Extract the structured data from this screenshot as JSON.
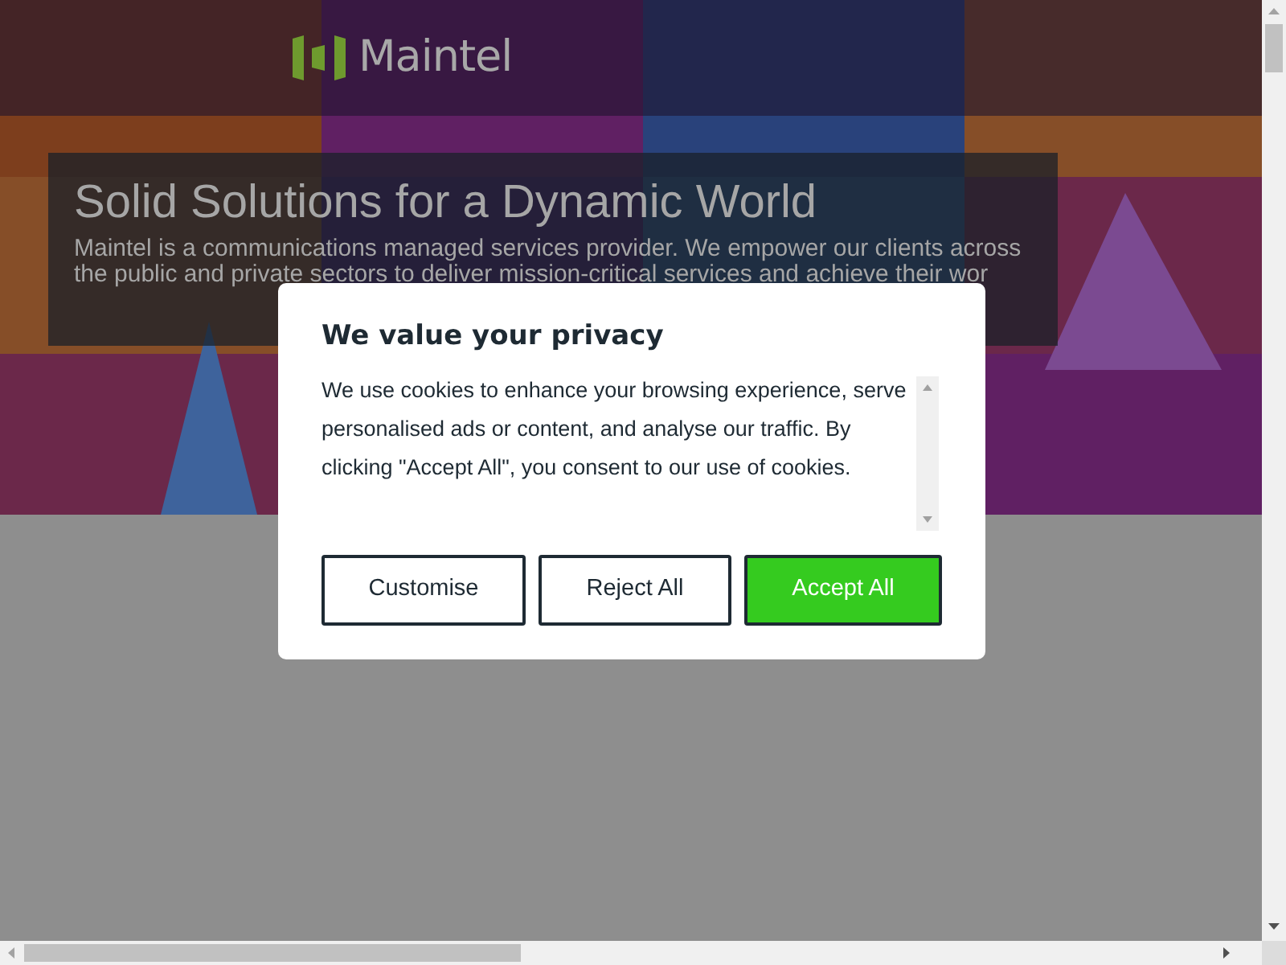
{
  "header": {
    "logo_text": "Maintel"
  },
  "hero": {
    "kind": "picture",
    "title": "Solid Solutions for a Dynamic World",
    "text": "Maintel is a communications managed services provider. We empower our clients across the public and private sectors to deliver mission-critical services and achieve their wor"
  },
  "cookie_dialog": {
    "title": "We value your privacy",
    "text": "We use cookies to enhance your browsing experience, serve personalised ads or content, and analyse our traffic. By clicking \"Accept All\", you consent to our use of cookies.",
    "buttons": [
      {
        "label": "Customise",
        "kind": "outline"
      },
      {
        "label": "Reject All",
        "kind": "outline"
      },
      {
        "label": "Accept All",
        "kind": "primary"
      }
    ]
  }
}
